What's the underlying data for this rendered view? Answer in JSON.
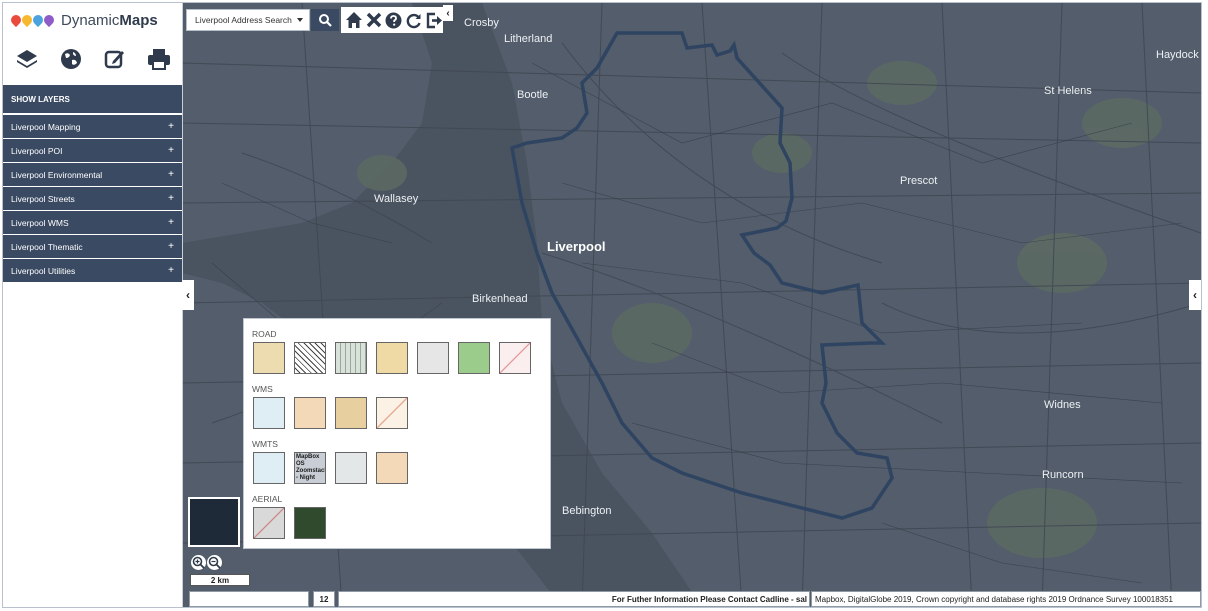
{
  "app": {
    "logo_prefix": "Dynamic",
    "logo_suffix": "Maps",
    "brand_pin_colors": [
      "#e94b3c",
      "#f5b82e",
      "#4aa3df",
      "#8e5bc7"
    ]
  },
  "toolbar": {
    "icons": [
      "layers-icon",
      "globe-icon",
      "edit-icon",
      "print-icon"
    ]
  },
  "sidebar": {
    "show_layers": "SHOW LAYERS",
    "items": [
      {
        "label": "Liverpool Mapping",
        "expand": "+"
      },
      {
        "label": "Liverpool POI",
        "expand": "+"
      },
      {
        "label": "Liverpool Environmental",
        "expand": "+"
      },
      {
        "label": "Liverpool Streets",
        "expand": "+"
      },
      {
        "label": "Liverpool WMS",
        "expand": "+"
      },
      {
        "label": "Liverpool Thematic",
        "expand": "+"
      },
      {
        "label": "Liverpool Utilities",
        "expand": "+"
      }
    ]
  },
  "search": {
    "value": "Liverpool Address Search"
  },
  "topbar": {
    "icons": [
      "home-icon",
      "close-icon",
      "help-icon",
      "refresh-icon",
      "logout-icon"
    ]
  },
  "basemap": {
    "sections": [
      {
        "title": "ROAD",
        "tiles": 7
      },
      {
        "title": "WMS",
        "tiles": 4
      },
      {
        "title": "WMTS",
        "tiles": 4,
        "tile_text": "MapBox OS Zoomstack - Night"
      },
      {
        "title": "AERIAL",
        "tiles": 2
      }
    ]
  },
  "map": {
    "places": [
      "Crosby",
      "Litherland",
      "Bootle",
      "Wallasey",
      "Liverpool",
      "Birkenhead",
      "Prescot",
      "St Helens",
      "Haydock",
      "Widnes",
      "Runcorn",
      "Bebington"
    ],
    "boundary_color": "#2e4461"
  },
  "scale": {
    "label": "2 km"
  },
  "status": {
    "zoom": "12",
    "contact": "For Futher Information Please Contact Cadline - sal",
    "attribution": "Mapbox, DigitalGlobe 2019, Crown copyright and database rights 2019 Ordnance Survey 100018351"
  }
}
